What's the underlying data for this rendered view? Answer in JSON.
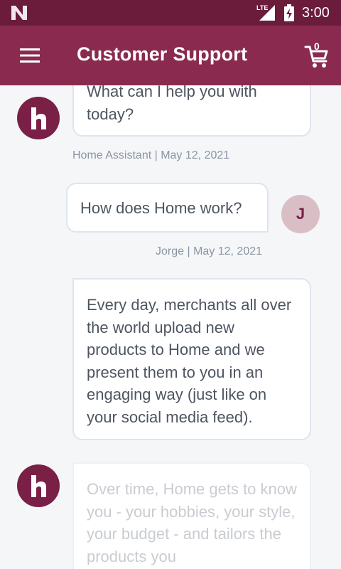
{
  "status_bar": {
    "network": "LTE",
    "time": "3:00"
  },
  "app_bar": {
    "title": "Customer Support",
    "cart_count": "0"
  },
  "messages": [
    {
      "sender": "bot",
      "text": "What can I help you with today?",
      "meta": "Home Assistant | May 12, 2021"
    },
    {
      "sender": "user",
      "avatar_initial": "J",
      "text": "How does Home work?",
      "meta": "Jorge | May 12, 2021"
    },
    {
      "sender": "bot",
      "text": "Every day, merchants all over the world upload new products to Home and we present them to you in an engaging way (just like on your social media feed)."
    },
    {
      "sender": "bot",
      "text": "Over time, Home gets to know you - your hobbies, your style, your budget - and tailors the products you"
    }
  ],
  "colors": {
    "status_bar": "#6b1c3b",
    "app_bar": "#8a2a4f",
    "brand_avatar": "#7a1f45",
    "user_avatar": "#d9bec6",
    "chat_background": "#f5f6f8"
  },
  "icons": {
    "status_logo": "n-logo-icon",
    "signal": "signal-icon",
    "battery": "battery-charging-icon",
    "menu": "hamburger-menu-icon",
    "cart": "shopping-cart-icon",
    "bot_avatar": "home-h-logo-icon"
  }
}
